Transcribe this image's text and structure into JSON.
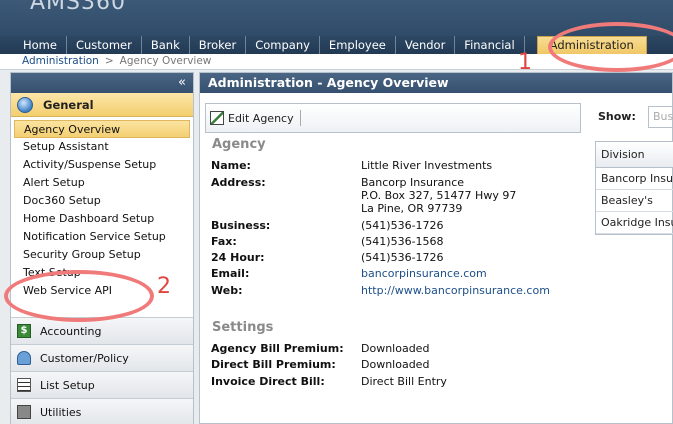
{
  "app": {
    "logo_text": "AMS360"
  },
  "nav": {
    "items": [
      "Home",
      "Customer",
      "Bank",
      "Broker",
      "Company",
      "Employee",
      "Vendor",
      "Financial"
    ],
    "active": "Administration"
  },
  "breadcrumb": {
    "root": "Administration",
    "sep": ">",
    "current": "Agency Overview"
  },
  "sidebar": {
    "collapse_glyph": "«",
    "section": "General",
    "items": [
      "Agency Overview",
      "Setup Assistant",
      "Activity/Suspense Setup",
      "Alert Setup",
      "Doc360 Setup",
      "Home Dashboard Setup",
      "Notification Service Setup",
      "Security Group Setup",
      "Text Setup",
      "Web Service API"
    ],
    "groups": [
      "Accounting",
      "Customer/Policy",
      "List Setup",
      "Utilities"
    ]
  },
  "main": {
    "title": "Administration - Agency Overview",
    "toolbar": {
      "edit_label": "Edit Agency"
    },
    "agency": {
      "heading": "Agency",
      "name_label": "Name:",
      "name": "Little River Investments",
      "address_label": "Address:",
      "address1": "Bancorp Insurance",
      "address2": "P.O. Box 327, 51477 Hwy 97",
      "address3": "La Pine, OR 97739",
      "business_label": "Business:",
      "business": "(541)536-1726",
      "fax_label": "Fax:",
      "fax": "(541)536-1568",
      "hour24_label": "24 Hour:",
      "hour24": "(541)536-1726",
      "email_label": "Email:",
      "email": "bancorpinsurance.com",
      "web_label": "Web:",
      "web": "http://www.bancorpinsurance.com"
    },
    "settings": {
      "heading": "Settings",
      "agency_bill_label": "Agency Bill Premium:",
      "agency_bill": "Downloaded",
      "direct_bill_label": "Direct Bill Premium:",
      "direct_bill": "Downloaded",
      "invoice_label": "Invoice Direct Bill:",
      "invoice": "Direct Bill Entry"
    },
    "right": {
      "show_label": "Show:",
      "show_placeholder": "Bus",
      "division_header": "Division",
      "divisions": [
        "Bancorp Insu",
        "Beasley's",
        "Oakridge Insu"
      ]
    }
  },
  "annotations": {
    "one": "1",
    "two": "2"
  },
  "colors": {
    "accent": "#f4cf6f",
    "header": "#34506e",
    "callout": "#f07a7a"
  }
}
